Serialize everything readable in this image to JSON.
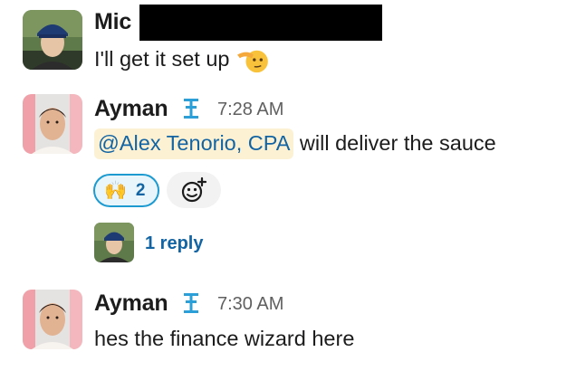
{
  "messages": [
    {
      "author": "Mic",
      "text": "I'll get it set up",
      "emoji": "saluting-face"
    },
    {
      "author": "Ayman",
      "time": "7:28 AM",
      "mention": "@Alex Tenorio, CPA",
      "text": " will deliver the sauce",
      "reaction": {
        "emoji": "🙌",
        "count": "2"
      },
      "thread": {
        "reply_label": "1 reply"
      }
    },
    {
      "author": "Ayman",
      "time": "7:30 AM",
      "text": "hes the finance wizard here"
    }
  ],
  "colors": {
    "mention_bg": "#fdf1d4",
    "link": "#1264a3",
    "reaction_border": "#1d9bd1",
    "reaction_bg": "#e8f5fa"
  },
  "icons": [
    "app-badge-icon",
    "add-reaction-icon",
    "saluting-face-icon"
  ]
}
